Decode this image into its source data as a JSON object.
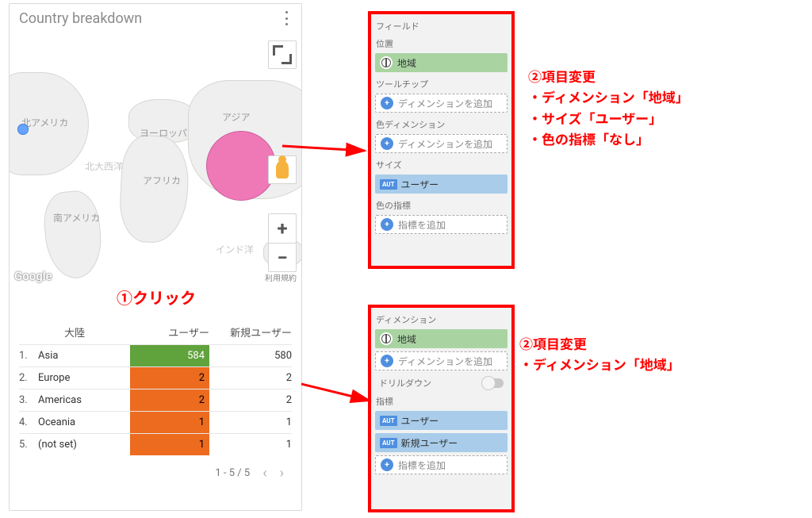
{
  "card": {
    "title": "Country breakdown",
    "map_labels": {
      "europe": "ヨーロッパ",
      "asia": "アジア",
      "africa": "アフリカ",
      "north_america": "北アメリカ",
      "south_america": "南アメリカ",
      "north_atlantic": "北大西洋",
      "indian": "インド洋"
    },
    "google_logo": "Google",
    "terms": "利用規約",
    "click_annotation": "①クリック",
    "table": {
      "headers": {
        "continent": "大陸",
        "users": "ユーザー",
        "new_users": "新規ユーザー"
      },
      "rows": [
        {
          "idx": "1.",
          "name": "Asia",
          "users": "584",
          "new_users": "580",
          "color": "green"
        },
        {
          "idx": "2.",
          "name": "Europe",
          "users": "2",
          "new_users": "2",
          "color": "orange"
        },
        {
          "idx": "3.",
          "name": "Americas",
          "users": "2",
          "new_users": "2",
          "color": "orange"
        },
        {
          "idx": "4.",
          "name": "Oceania",
          "users": "1",
          "new_users": "1",
          "color": "orange"
        },
        {
          "idx": "5.",
          "name": "(not set)",
          "users": "1",
          "new_users": "1",
          "color": "orange"
        }
      ],
      "pager": "1 - 5 / 5"
    }
  },
  "panel_top": {
    "fields_h": "フィールド",
    "position_h": "位置",
    "position_chip": "地域",
    "tooltip_h": "ツールチップ",
    "add_dimension": "ディメンションを追加",
    "color_dim_h": "色ディメンション",
    "size_h": "サイズ",
    "size_chip": "ユーザー",
    "color_metric_h": "色の指標",
    "add_metric": "指標を追加",
    "aut": "AUT"
  },
  "panel_bottom": {
    "dimension_h": "ディメンション",
    "dimension_chip": "地域",
    "add_dimension": "ディメンションを追加",
    "drilldown": "ドリルダウン",
    "metrics_h": "指標",
    "metric1": "ユーザー",
    "metric2": "新規ユーザー",
    "add_metric": "指標を追加",
    "aut": "AUT"
  },
  "notes": {
    "top": "②項目変更\n・ディメンション「地域」\n・サイズ「ユーザー」\n・色の指標「なし」",
    "bottom": "②項目変更\n・ディメンション「地域」"
  },
  "chart_data": {
    "type": "table",
    "columns": [
      "大陸",
      "ユーザー",
      "新規ユーザー"
    ],
    "rows": [
      [
        "Asia",
        584,
        580
      ],
      [
        "Europe",
        2,
        2
      ],
      [
        "Americas",
        2,
        2
      ],
      [
        "Oceania",
        1,
        1
      ],
      [
        "(not set)",
        1,
        1
      ]
    ]
  }
}
